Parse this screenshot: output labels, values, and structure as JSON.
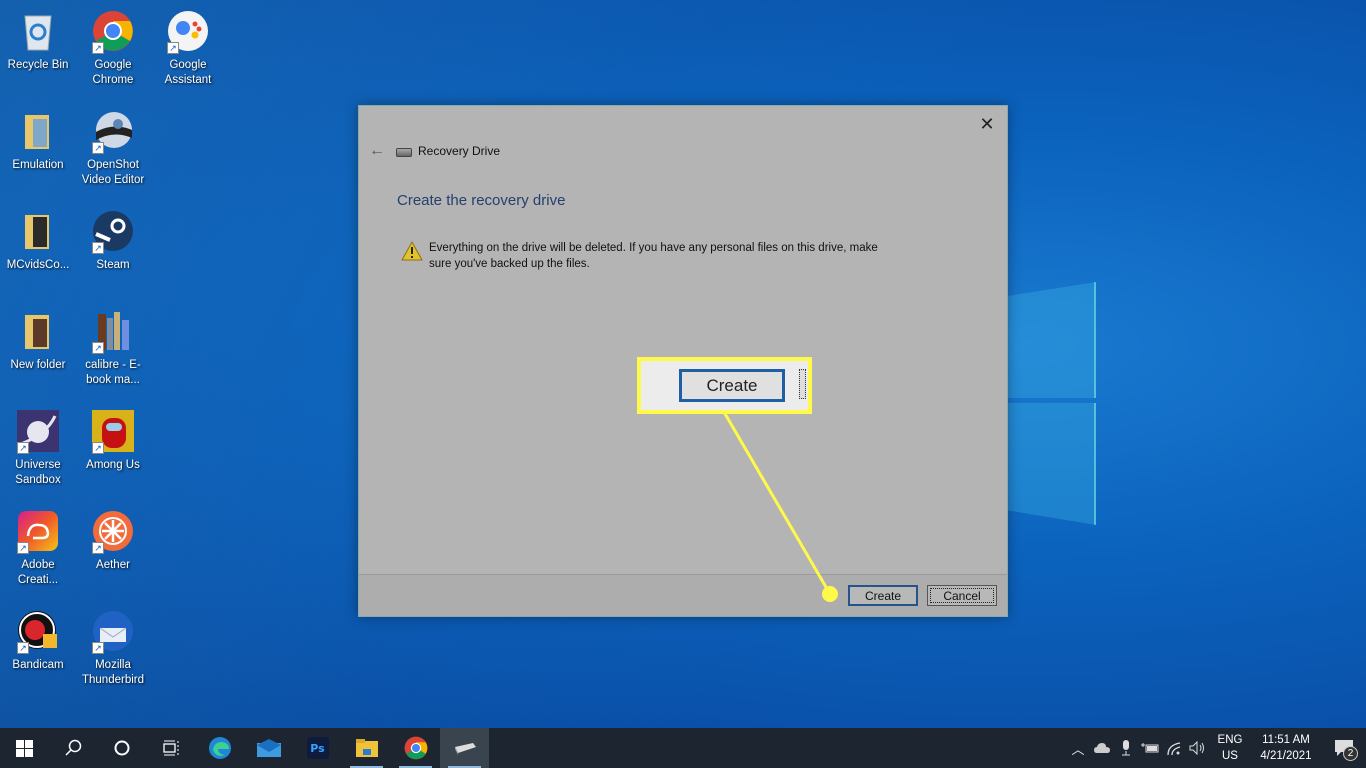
{
  "desktop": {
    "icons": [
      {
        "label": "Recycle Bin",
        "icon": "recycle-bin-icon",
        "shortcut": false
      },
      {
        "label": "Google Chrome",
        "icon": "chrome-icon",
        "shortcut": true
      },
      {
        "label": "Google Assistant",
        "icon": "google-assistant-icon",
        "shortcut": true
      },
      {
        "label": "Emulation",
        "icon": "folder-icon",
        "shortcut": false
      },
      {
        "label": "OpenShot Video Editor",
        "icon": "openshot-icon",
        "shortcut": true
      },
      {
        "label": "MCvidsCo...",
        "icon": "folder-icon",
        "shortcut": false
      },
      {
        "label": "Steam",
        "icon": "steam-icon",
        "shortcut": true
      },
      {
        "label": "New folder",
        "icon": "folder-icon",
        "shortcut": false
      },
      {
        "label": "calibre - E-book ma...",
        "icon": "calibre-icon",
        "shortcut": true
      },
      {
        "label": "Universe Sandbox",
        "icon": "universe-sandbox-icon",
        "shortcut": true
      },
      {
        "label": "Among Us",
        "icon": "among-us-icon",
        "shortcut": true
      },
      {
        "label": "Adobe Creati...",
        "icon": "adobe-cc-icon",
        "shortcut": true
      },
      {
        "label": "Aether",
        "icon": "aether-icon",
        "shortcut": true
      },
      {
        "label": "Bandicam",
        "icon": "bandicam-icon",
        "shortcut": true
      },
      {
        "label": "Mozilla Thunderbird",
        "icon": "thunderbird-icon",
        "shortcut": true
      }
    ]
  },
  "dialog": {
    "window_title": "Recovery Drive",
    "heading": "Create the recovery drive",
    "warning": "Everything on the drive will be deleted. If you have any personal files on this drive, make sure you've backed up the files.",
    "create_label": "Create",
    "cancel_label": "Cancel",
    "close_glyph": "✕",
    "back_glyph": "←"
  },
  "callout": {
    "label": "Create",
    "color": "#fff94a"
  },
  "taskbar": {
    "pinned": [
      {
        "name": "start-button",
        "icon": "windows-logo-icon"
      },
      {
        "name": "search-button",
        "icon": "search-icon"
      },
      {
        "name": "cortana-button",
        "icon": "cortana-circle-icon"
      },
      {
        "name": "task-view-button",
        "icon": "task-view-icon"
      },
      {
        "name": "edge-button",
        "icon": "edge-icon"
      },
      {
        "name": "mail-button",
        "icon": "mail-icon"
      },
      {
        "name": "photoshop-button",
        "icon": "photoshop-icon",
        "text": "Ps"
      },
      {
        "name": "file-explorer-button",
        "icon": "file-explorer-icon"
      },
      {
        "name": "chrome-button",
        "icon": "chrome-icon"
      },
      {
        "name": "recovery-drive-button",
        "icon": "drive-icon"
      }
    ],
    "tray": {
      "language_top": "ENG",
      "language_bottom": "US",
      "time": "11:51 AM",
      "date": "4/21/2021",
      "notification_count": "2"
    }
  },
  "colors": {
    "accent": "#1f5fa4",
    "highlight": "#fff94a",
    "heading": "#24406e"
  }
}
